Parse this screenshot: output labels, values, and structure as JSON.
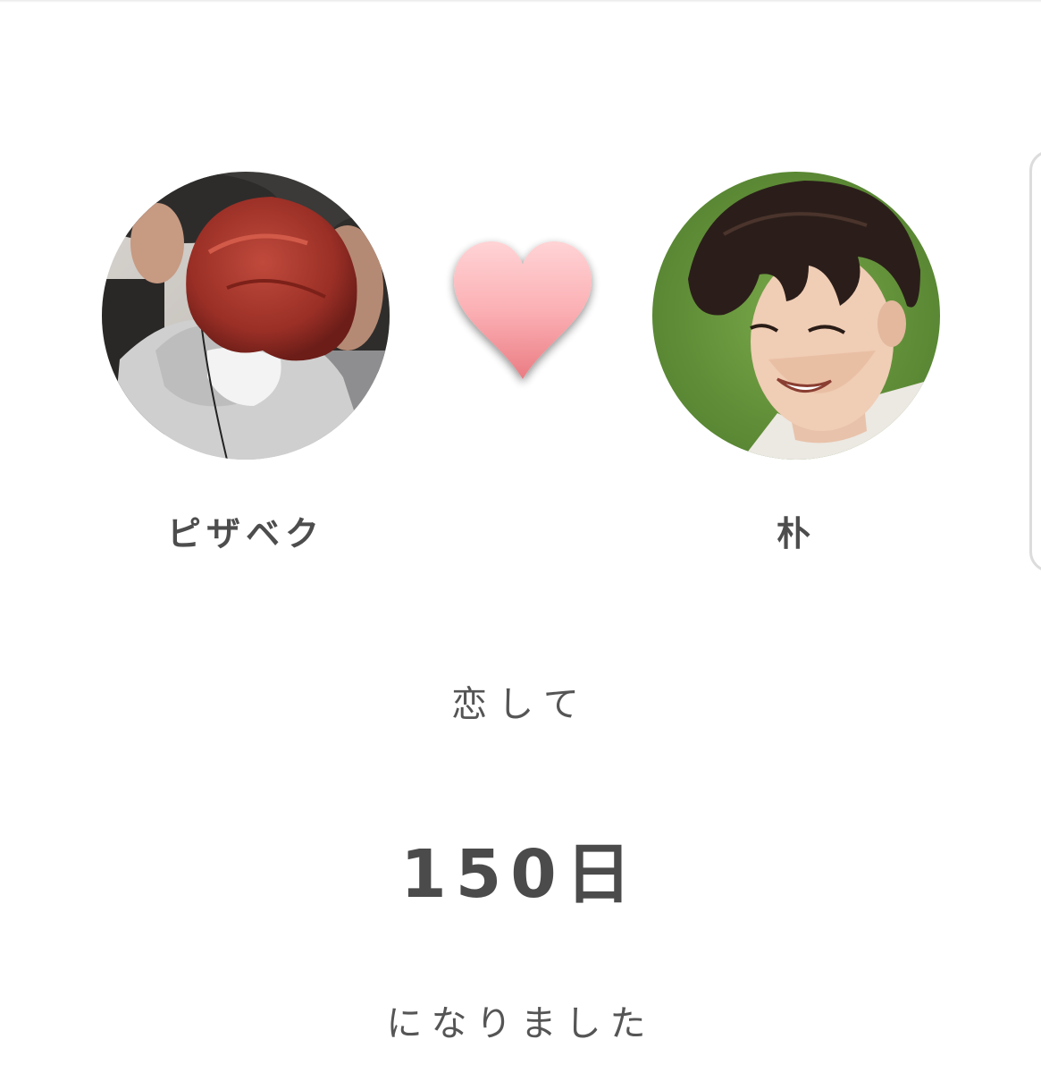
{
  "partners": {
    "left": {
      "name": "ピザベク",
      "avatar_icon": "photo-avatar-red-hair-mask"
    },
    "right": {
      "name": "朴",
      "avatar_icon": "photo-avatar-smiling-green-bg"
    }
  },
  "heart_icon": "heart-icon",
  "counter": {
    "prefix": "恋して",
    "days": "150日",
    "suffix": "になりました"
  },
  "colors": {
    "heart_top": "#ffc6c8",
    "heart_bottom": "#f08a90",
    "text": "#4b4b4b",
    "right_avatar_bg": "#5a8a32"
  }
}
